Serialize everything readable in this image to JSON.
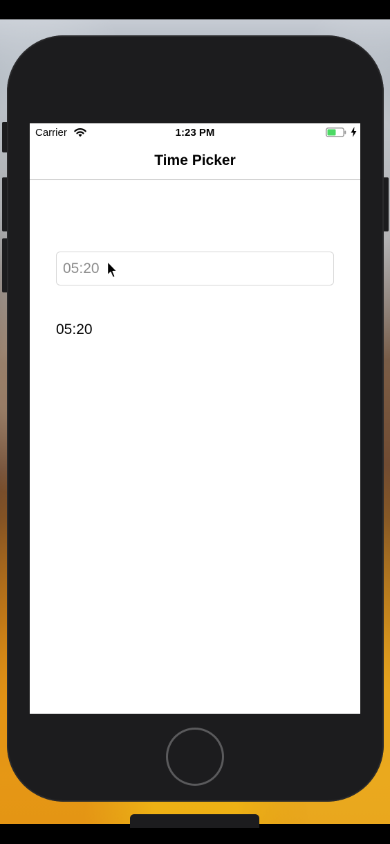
{
  "status_bar": {
    "carrier": "Carrier",
    "time": "1:23 PM",
    "battery_color": "#4cd964",
    "icons": [
      "wifi-icon",
      "battery-icon",
      "charging-bolt-icon"
    ]
  },
  "navigation": {
    "title": "Time Picker"
  },
  "time_input": {
    "placeholder": "05:20",
    "value": ""
  },
  "time_label": {
    "text": "05:20"
  },
  "device": {
    "home_button_icon": "home-button-ring",
    "pointer_icon": "mouse-pointer-icon"
  }
}
